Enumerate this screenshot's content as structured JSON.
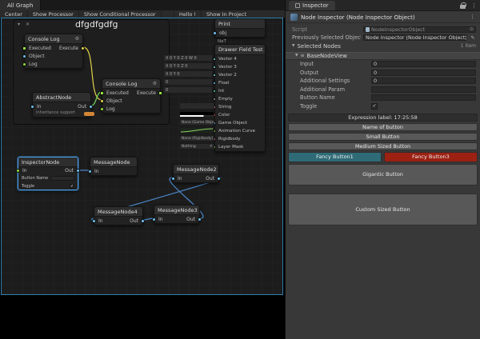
{
  "icons": {
    "gear": "⚙",
    "check": "✓",
    "kebab": "⋮",
    "picker": "⊙",
    "pencil": "✎",
    "arrow_down": "▼",
    "chevron_down": "▾",
    "close": "✕",
    "list": "≡",
    "dropdown": "▾"
  },
  "palette": {
    "exec_green": "#96e03c",
    "object_blue": "#6fc2f0",
    "yellow_wire": "#e3d44a",
    "green_wire": "#6fd65a",
    "blue_wire": "#4a86c8",
    "selection_outline": "#2d7da8",
    "orange_badge": "#d28435",
    "fancy1": "#2f6b77",
    "fancy3": "#9c2113"
  },
  "graph": {
    "tab": "All Graph",
    "toolbar": {
      "center": "Center",
      "show_processor": "Show Processor",
      "show_conditional_processor": "Show Conditional Processor",
      "hello": "Hello !",
      "show_in_project": "Show In Project"
    },
    "title": "dfgdfgdfg",
    "console_log_a": {
      "title": "Console Log",
      "exec_in": "Executed",
      "exec_out": "Execute",
      "object": "Object",
      "log": "Log"
    },
    "console_log_b": {
      "title": "Console Log",
      "exec_in": "Executed",
      "exec_out": "Execute",
      "object": "Object",
      "log": "Log"
    },
    "abstract_node": {
      "title": "AbstractNode",
      "in": "In",
      "out": "Out",
      "footer": "Inheritance support"
    },
    "print_node": {
      "title": "Print",
      "port": "obj",
      "value": "NaT"
    },
    "drawer_node": {
      "title": "Drawer Field Test",
      "ports": [
        {
          "label": "Vector 4",
          "color": "#84e0dc"
        },
        {
          "label": "Vector 3",
          "color": "#84e0dc"
        },
        {
          "label": "Vector 2",
          "color": "#84e0dc"
        },
        {
          "label": "Float",
          "color": "#6fc2f0"
        },
        {
          "label": "Int",
          "color": "#55d6a9"
        },
        {
          "label": "Empty",
          "color": "#9a9a9a"
        },
        {
          "label": "String",
          "color": "#f48fb9"
        },
        {
          "label": "Color",
          "color": "#ee5757"
        },
        {
          "label": "Game Object",
          "color": "#6fc2f0"
        },
        {
          "label": "Animation Curve",
          "color": "#a6e85c"
        },
        {
          "label": "Rigidbody",
          "color": "#f07b7b"
        },
        {
          "label": "Layer Mask",
          "color": "#8ad65f"
        }
      ]
    },
    "drawer_mini": {
      "rows": [
        "X 0  Y 0  Z 0  W 0",
        "X 0  Y 0  Z 0",
        "X 0  Y 0",
        "0",
        "0"
      ],
      "string_value": ""
    },
    "drawer_widgets": {
      "game_object": "None (Game Object)",
      "rigidbody": "None (Rigidbody)",
      "layer_mask": "Nothing"
    },
    "inspector_node": {
      "title": "InspectorNode",
      "in": "In",
      "out": "Out",
      "button_name": "Button Name",
      "toggle": "Toggle",
      "toggle_checked": true
    },
    "message_node": {
      "title": "MessageNode",
      "in": "In"
    },
    "message_node2": {
      "title": "MessageNode2",
      "in": "In",
      "out": "Out"
    },
    "message_node3": {
      "title": "MessageNode3",
      "in": "In",
      "out": "Out"
    },
    "message_node4": {
      "title": "MessageNode4",
      "in": "In",
      "out": "Out"
    },
    "wires": [
      {
        "from": "Console Log.Execute",
        "to": "Console Log.Object",
        "color": "#e3d44a"
      },
      {
        "from": "AbstractNode.Out",
        "to": "Console Log.Executed",
        "color": "#6fd65a"
      },
      {
        "from": "InspectorNode.Out",
        "to": "MessageNode.In",
        "color": "#4a86c8"
      },
      {
        "from": "MessageNode2.Out",
        "to": "MessageNode4.In",
        "color": "#4a86c8"
      },
      {
        "from": "MessageNode4.Out",
        "to": "MessageNode3.In",
        "color": "#4a86c8"
      },
      {
        "from": "MessageNode3.Out",
        "to": "MessageNode2.In",
        "color": "#4a86c8"
      }
    ]
  },
  "inspector": {
    "tab": "Inspector",
    "header_title": "Node Inspector (Node Inspector Object)",
    "script": {
      "label": "Script",
      "value": "NodeInspectorObject"
    },
    "prev": {
      "label": "Previously Selected Object",
      "value": "Node Inspector (Node Inspector Object)"
    },
    "selected_nodes": {
      "label": "Selected Nodes",
      "count": "1 item"
    },
    "base_view": "BaseNodeView",
    "fields": [
      {
        "label": "Input",
        "value": "0"
      },
      {
        "label": "Output",
        "value": "0"
      },
      {
        "label": "Additional Settings",
        "value": "0"
      },
      {
        "label": "Additional Param",
        "value": ""
      },
      {
        "label": "Button Name",
        "value": ""
      },
      {
        "label": "Toggle",
        "checked": true
      }
    ],
    "expression_label": "Expression label: 17:25:58",
    "buttons": {
      "name_of_button": "Name of button",
      "small": "Small Button",
      "medium": "Medium Sized Button",
      "fancy1": "Fancy Button1",
      "fancy3": "Fancy Button3",
      "gigantic": "Gigantic Button",
      "custom": "Custom Sized Button"
    }
  }
}
